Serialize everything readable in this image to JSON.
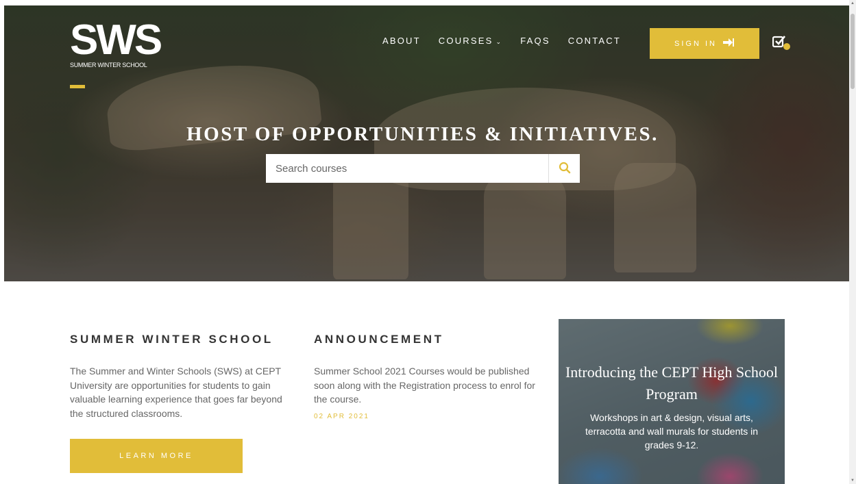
{
  "header": {
    "logo_mark": "SWS",
    "logo_subtitle": "SUMMER WINTER SCHOOL",
    "nav": [
      {
        "label": "ABOUT"
      },
      {
        "label": "COURSES"
      },
      {
        "label": "FAQS"
      },
      {
        "label": "CONTACT"
      }
    ],
    "signin_label": "SIGN IN",
    "accent_color": "#e1bd39"
  },
  "hero": {
    "title": "HOST OF OPPORTUNITIES & INITIATIVES.",
    "search_placeholder": "Search courses"
  },
  "about": {
    "heading": "SUMMER WINTER SCHOOL",
    "text": "The Summer and Winter Schools (SWS) at CEPT University are opportunities for students to gain valuable learning experience that goes far beyond the structured classrooms.",
    "button_label": "LEARN MORE"
  },
  "announcement": {
    "heading": "ANNOUNCEMENT",
    "text": "Summer School 2021 Courses would be published soon along with the Registration process to enrol for the course.",
    "date": "02 APR 2021"
  },
  "promo": {
    "title": "Introducing the CEPT High School Program",
    "text": "Workshops in art & design, visual arts, terracotta and wall murals for students in grades 9-12."
  }
}
